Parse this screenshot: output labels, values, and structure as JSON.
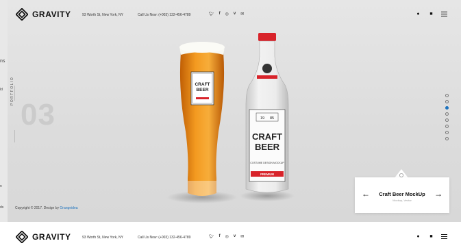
{
  "header": {
    "logo_text": "GRAVITY",
    "address": "93 Worth St, New York, NY",
    "phone": "Call Us Now: (+003) 132-456-4789",
    "social": [
      "twitter-icon",
      "facebook-icon",
      "instagram-icon",
      "vimeo-icon",
      "email-icon"
    ]
  },
  "left_fragments": [
    "ns",
    "ld",
    "n",
    "ds"
  ],
  "section": {
    "number": "03",
    "label": "PORTFOLIO"
  },
  "slider": {
    "count": 8,
    "active_index": 2
  },
  "product": {
    "glass_label": [
      "CRAFT",
      "BEER"
    ],
    "bottle_year": [
      "19",
      "85"
    ],
    "bottle_label": [
      "CRAFT",
      "BEER"
    ],
    "bottle_sub": "COSTUME DESIGN MOCKUP",
    "bottle_premium": "PREMIUM"
  },
  "card": {
    "title": "Craft Beer MockUp",
    "subtitle": "Mockup, Vector"
  },
  "footer": {
    "copyright": "Copyright © 2017. Design by ",
    "designer": "Orangeidea"
  },
  "colors": {
    "accent": "#1e73be",
    "bottle_red": "#d8232a",
    "beer": "#e8850f"
  }
}
